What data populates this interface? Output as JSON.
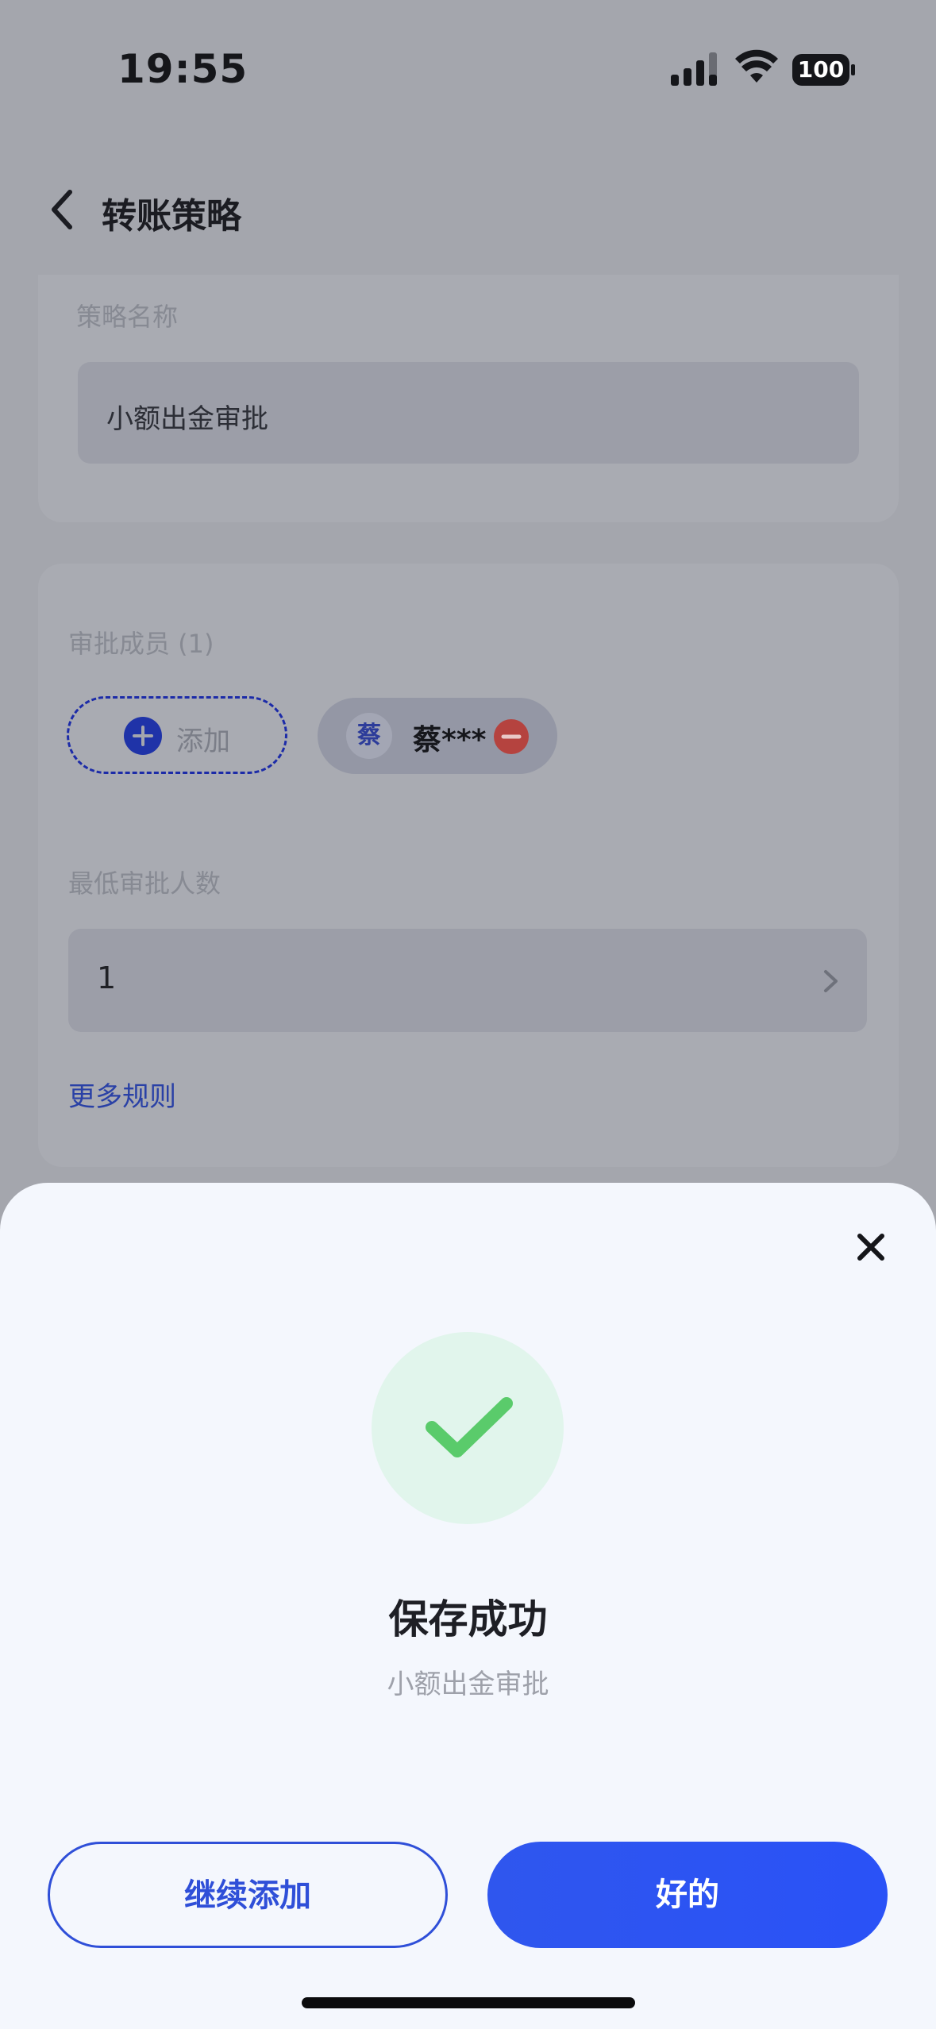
{
  "status_bar": {
    "time": "19:55",
    "battery": "100"
  },
  "header": {
    "title": "转账策略"
  },
  "strategy": {
    "label": "策略名称",
    "value": "小额出金审批"
  },
  "approvers": {
    "label": "审批成员 (1)",
    "add_label": "添加",
    "members": [
      {
        "avatar": "蔡",
        "name": "蔡***"
      }
    ]
  },
  "min_approvers": {
    "label": "最低审批人数",
    "value": "1"
  },
  "more_rules": "更多规则",
  "dialog": {
    "title": "保存成功",
    "subtitle": "小额出金审批",
    "continue_label": "继续添加",
    "ok_label": "好的"
  },
  "colors": {
    "accent": "#2F56EE",
    "success": "#5ACB6B",
    "danger": "#D9534F"
  }
}
